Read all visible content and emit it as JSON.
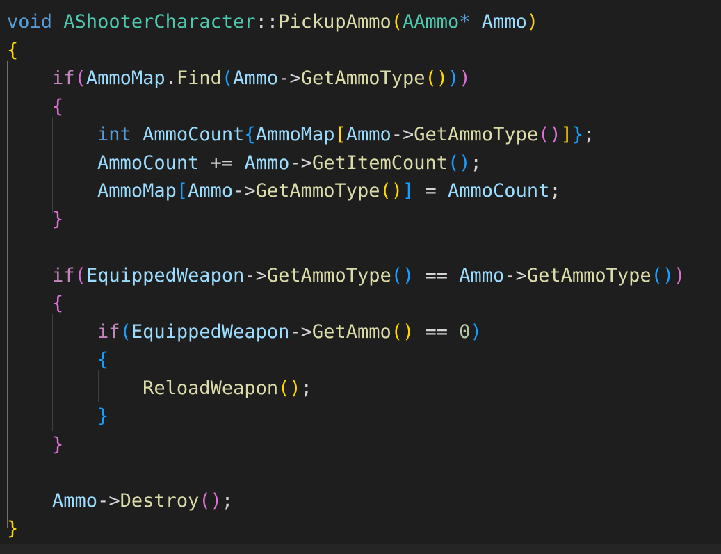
{
  "colors": {
    "background": "#1e1e1e",
    "keyword": "#569cd6",
    "control": "#c586c0",
    "type": "#4ec9b0",
    "function": "#dcdcaa",
    "variable": "#9cdcfe",
    "number": "#b5cea8",
    "punctuation": "#d4d4d4",
    "bracket_gold": "#ffd700",
    "bracket_orchid": "#da70d6",
    "bracket_blue": "#179fff"
  },
  "code": {
    "language": "cpp",
    "lines": [
      [
        {
          "t": "void",
          "c": "keyword"
        },
        {
          "t": " ",
          "c": "punctuation"
        },
        {
          "t": "AShooterCharacter",
          "c": "type"
        },
        {
          "t": "::",
          "c": "punctuation"
        },
        {
          "t": "PickupAmmo",
          "c": "function"
        },
        {
          "t": "(",
          "c": "bracket_gold"
        },
        {
          "t": "AAmmo",
          "c": "type"
        },
        {
          "t": "*",
          "c": "keyword"
        },
        {
          "t": " ",
          "c": "punctuation"
        },
        {
          "t": "Ammo",
          "c": "variable"
        },
        {
          "t": ")",
          "c": "bracket_gold"
        }
      ],
      [
        {
          "t": "{",
          "c": "bracket_gold"
        }
      ],
      [
        {
          "t": "    ",
          "c": "punctuation"
        },
        {
          "t": "if",
          "c": "control"
        },
        {
          "t": "(",
          "c": "bracket_orchid"
        },
        {
          "t": "AmmoMap",
          "c": "variable"
        },
        {
          "t": ".",
          "c": "punctuation"
        },
        {
          "t": "Find",
          "c": "function"
        },
        {
          "t": "(",
          "c": "bracket_blue"
        },
        {
          "t": "Ammo",
          "c": "variable"
        },
        {
          "t": "->",
          "c": "punctuation"
        },
        {
          "t": "GetAmmoType",
          "c": "function"
        },
        {
          "t": "()",
          "c": "bracket_gold"
        },
        {
          "t": ")",
          "c": "bracket_blue"
        },
        {
          "t": ")",
          "c": "bracket_orchid"
        }
      ],
      [
        {
          "t": "    ",
          "c": "punctuation"
        },
        {
          "t": "{",
          "c": "bracket_orchid"
        }
      ],
      [
        {
          "t": "        ",
          "c": "punctuation"
        },
        {
          "t": "int",
          "c": "keyword"
        },
        {
          "t": " ",
          "c": "punctuation"
        },
        {
          "t": "AmmoCount",
          "c": "variable"
        },
        {
          "t": "{",
          "c": "bracket_blue"
        },
        {
          "t": "AmmoMap",
          "c": "variable"
        },
        {
          "t": "[",
          "c": "bracket_gold"
        },
        {
          "t": "Ammo",
          "c": "variable"
        },
        {
          "t": "->",
          "c": "punctuation"
        },
        {
          "t": "GetAmmoType",
          "c": "function"
        },
        {
          "t": "()",
          "c": "bracket_orchid"
        },
        {
          "t": "]",
          "c": "bracket_gold"
        },
        {
          "t": "}",
          "c": "bracket_blue"
        },
        {
          "t": ";",
          "c": "punctuation"
        }
      ],
      [
        {
          "t": "        ",
          "c": "punctuation"
        },
        {
          "t": "AmmoCount",
          "c": "variable"
        },
        {
          "t": " += ",
          "c": "punctuation"
        },
        {
          "t": "Ammo",
          "c": "variable"
        },
        {
          "t": "->",
          "c": "punctuation"
        },
        {
          "t": "GetItemCount",
          "c": "function"
        },
        {
          "t": "()",
          "c": "bracket_blue"
        },
        {
          "t": ";",
          "c": "punctuation"
        }
      ],
      [
        {
          "t": "        ",
          "c": "punctuation"
        },
        {
          "t": "AmmoMap",
          "c": "variable"
        },
        {
          "t": "[",
          "c": "bracket_blue"
        },
        {
          "t": "Ammo",
          "c": "variable"
        },
        {
          "t": "->",
          "c": "punctuation"
        },
        {
          "t": "GetAmmoType",
          "c": "function"
        },
        {
          "t": "()",
          "c": "bracket_gold"
        },
        {
          "t": "]",
          "c": "bracket_blue"
        },
        {
          "t": " = ",
          "c": "punctuation"
        },
        {
          "t": "AmmoCount",
          "c": "variable"
        },
        {
          "t": ";",
          "c": "punctuation"
        }
      ],
      [
        {
          "t": "    ",
          "c": "punctuation"
        },
        {
          "t": "}",
          "c": "bracket_orchid"
        }
      ],
      [],
      [
        {
          "t": "    ",
          "c": "punctuation"
        },
        {
          "t": "if",
          "c": "control"
        },
        {
          "t": "(",
          "c": "bracket_orchid"
        },
        {
          "t": "EquippedWeapon",
          "c": "variable"
        },
        {
          "t": "->",
          "c": "punctuation"
        },
        {
          "t": "GetAmmoType",
          "c": "function"
        },
        {
          "t": "()",
          "c": "bracket_blue"
        },
        {
          "t": " == ",
          "c": "punctuation"
        },
        {
          "t": "Ammo",
          "c": "variable"
        },
        {
          "t": "->",
          "c": "punctuation"
        },
        {
          "t": "GetAmmoType",
          "c": "function"
        },
        {
          "t": "()",
          "c": "bracket_blue"
        },
        {
          "t": ")",
          "c": "bracket_orchid"
        }
      ],
      [
        {
          "t": "    ",
          "c": "punctuation"
        },
        {
          "t": "{",
          "c": "bracket_orchid"
        }
      ],
      [
        {
          "t": "        ",
          "c": "punctuation"
        },
        {
          "t": "if",
          "c": "control"
        },
        {
          "t": "(",
          "c": "bracket_blue"
        },
        {
          "t": "EquippedWeapon",
          "c": "variable"
        },
        {
          "t": "->",
          "c": "punctuation"
        },
        {
          "t": "GetAmmo",
          "c": "function"
        },
        {
          "t": "()",
          "c": "bracket_gold"
        },
        {
          "t": " == ",
          "c": "punctuation"
        },
        {
          "t": "0",
          "c": "number"
        },
        {
          "t": ")",
          "c": "bracket_blue"
        }
      ],
      [
        {
          "t": "        ",
          "c": "punctuation"
        },
        {
          "t": "{",
          "c": "bracket_blue"
        }
      ],
      [
        {
          "t": "            ",
          "c": "punctuation"
        },
        {
          "t": "ReloadWeapon",
          "c": "function"
        },
        {
          "t": "()",
          "c": "bracket_gold"
        },
        {
          "t": ";",
          "c": "punctuation"
        }
      ],
      [
        {
          "t": "        ",
          "c": "punctuation"
        },
        {
          "t": "}",
          "c": "bracket_blue"
        }
      ],
      [
        {
          "t": "    ",
          "c": "punctuation"
        },
        {
          "t": "}",
          "c": "bracket_orchid"
        }
      ],
      [],
      [
        {
          "t": "    ",
          "c": "punctuation"
        },
        {
          "t": "Ammo",
          "c": "variable"
        },
        {
          "t": "->",
          "c": "punctuation"
        },
        {
          "t": "Destroy",
          "c": "function"
        },
        {
          "t": "()",
          "c": "bracket_orchid"
        },
        {
          "t": ";",
          "c": "punctuation"
        }
      ],
      [
        {
          "t": "}",
          "c": "bracket_gold"
        }
      ]
    ]
  }
}
